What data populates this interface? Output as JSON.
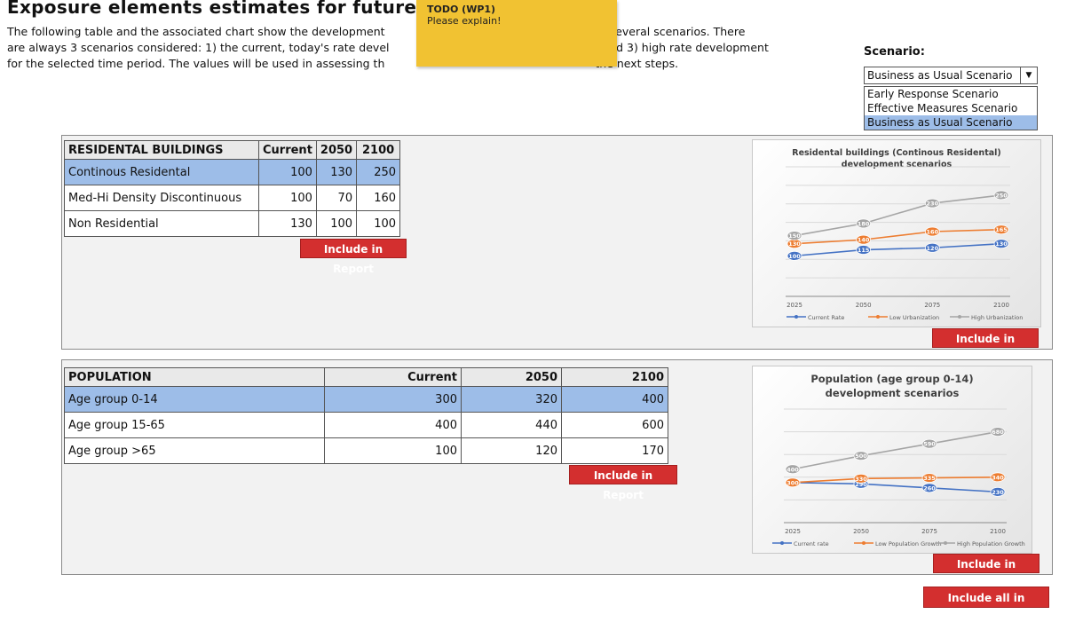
{
  "header": {
    "title": "Exposure elements estimates for future",
    "intro_line1": "The following table and the associated chart show the development",
    "intro_line1b": "for several scenarios. There",
    "intro_line2": "are always 3 scenarios considered: 1) the current, today's rate devel",
    "intro_line2b": "and 3) high rate development",
    "intro_line3": "for the selected time period. The values will be used in assessing th",
    "intro_line3b": "the next steps."
  },
  "note": {
    "title": "TODO (WP1)",
    "body": "Please explain!"
  },
  "scenario": {
    "label": "Scenario:",
    "selected": "Business as Usual Scenario",
    "options": [
      "Early Response Scenario",
      "Effective Measures Scenario",
      "Business as Usual Scenario"
    ]
  },
  "residential": {
    "headers": [
      "RESIDENTAL BUILDINGS",
      "Current",
      "2050",
      "2100"
    ],
    "rows": [
      [
        "Continous Residental",
        "100",
        "130",
        "250"
      ],
      [
        "Med-Hi Density Discontinuous",
        "100",
        "70",
        "160"
      ],
      [
        "Non Residential",
        "130",
        "100",
        "100"
      ]
    ],
    "include_label": "Include in Report"
  },
  "population": {
    "headers": [
      "POPULATION",
      "Current",
      "2050",
      "2100"
    ],
    "rows": [
      [
        "Age group 0-14",
        "300",
        "320",
        "400"
      ],
      [
        "Age group 15-65",
        "400",
        "440",
        "600"
      ],
      [
        "Age group >65",
        "100",
        "120",
        "170"
      ]
    ],
    "include_label": "Include in Report"
  },
  "chart_res_include": "Include in Report",
  "chart_pop_include": "Include in Report",
  "include_all_label": "Include all in Report",
  "colors": {
    "blue": "#4472c4",
    "orange": "#ed7d31",
    "gray": "#a5a5a5",
    "red_button": "#d32f2f",
    "highlight": "#9dbde8",
    "note": "#f1c232"
  },
  "chart_data": [
    {
      "type": "line",
      "title": "Residental buildings (Continous Residental) development scenarios",
      "x": [
        "2025",
        "2050",
        "2075",
        "2100"
      ],
      "series": [
        {
          "name": "Current Rate",
          "values": [
            100,
            115,
            120,
            130
          ]
        },
        {
          "name": "Low Urbanization",
          "values": [
            130,
            140,
            160,
            165
          ]
        },
        {
          "name": "High Urbanization",
          "values": [
            150,
            180,
            230,
            250
          ]
        }
      ],
      "legend": "bottom"
    },
    {
      "type": "line",
      "title": "Population (age group 0-14) development scenarios",
      "x": [
        "2025",
        "2050",
        "2075",
        "2100"
      ],
      "series": [
        {
          "name": "Current rate",
          "values": [
            300,
            290,
            260,
            230
          ]
        },
        {
          "name": "Low Population Growth",
          "values": [
            300,
            330,
            335,
            340
          ]
        },
        {
          "name": "High Population Growth",
          "values": [
            400,
            500,
            590,
            680
          ]
        }
      ],
      "legend": "bottom"
    }
  ]
}
